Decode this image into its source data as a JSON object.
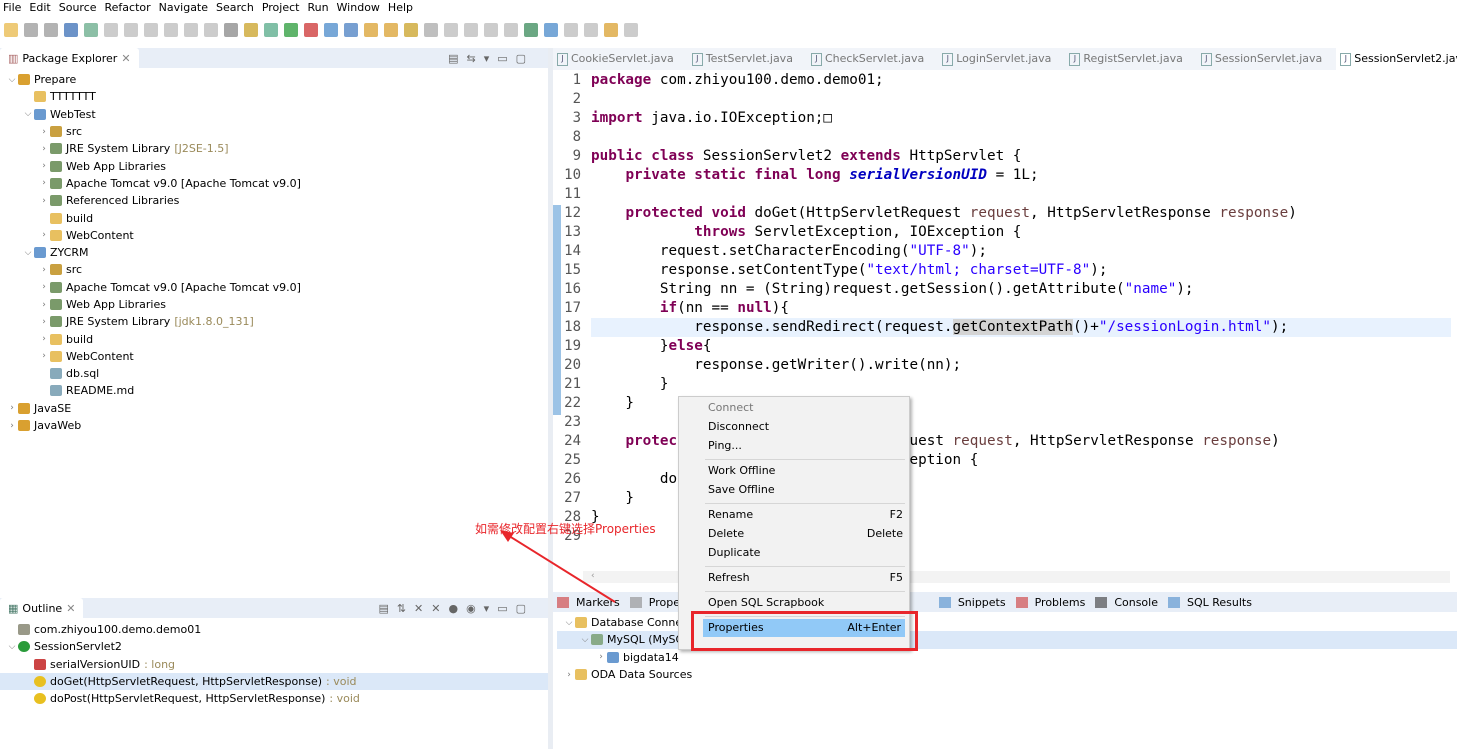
{
  "menu": [
    "File",
    "Edit",
    "Source",
    "Refactor",
    "Navigate",
    "Search",
    "Project",
    "Run",
    "Window",
    "Help"
  ],
  "package_explorer": {
    "title": "Package Explorer",
    "items": [
      {
        "label": "Prepare",
        "depth": 0,
        "open": true,
        "icon": "project-icon"
      },
      {
        "label": "TTTTTTT",
        "depth": 1,
        "icon": "folder-icon"
      },
      {
        "label": "WebTest",
        "depth": 1,
        "open": true,
        "icon": "web-project-icon"
      },
      {
        "label": "src",
        "depth": 2,
        "chev": true,
        "icon": "package-folder-icon"
      },
      {
        "label": "JRE System Library",
        "deco": "[J2SE-1.5]",
        "depth": 2,
        "chev": true,
        "icon": "library-icon"
      },
      {
        "label": "Web App Libraries",
        "depth": 2,
        "chev": true,
        "icon": "library-icon"
      },
      {
        "label": "Apache Tomcat v9.0 [Apache Tomcat v9.0]",
        "depth": 2,
        "chev": true,
        "icon": "library-icon"
      },
      {
        "label": "Referenced Libraries",
        "depth": 2,
        "chev": true,
        "icon": "library-icon"
      },
      {
        "label": "build",
        "depth": 2,
        "icon": "folder-icon"
      },
      {
        "label": "WebContent",
        "depth": 2,
        "chev": true,
        "icon": "folder-icon"
      },
      {
        "label": "ZYCRM",
        "depth": 1,
        "open": true,
        "icon": "web-project-icon"
      },
      {
        "label": "src",
        "depth": 2,
        "chev": true,
        "icon": "package-folder-icon"
      },
      {
        "label": "Apache Tomcat v9.0 [Apache Tomcat v9.0]",
        "depth": 2,
        "chev": true,
        "icon": "library-icon"
      },
      {
        "label": "Web App Libraries",
        "depth": 2,
        "chev": true,
        "icon": "library-icon"
      },
      {
        "label": "JRE System Library",
        "deco": "[jdk1.8.0_131]",
        "depth": 2,
        "chev": true,
        "icon": "library-icon"
      },
      {
        "label": "build",
        "depth": 2,
        "chev": true,
        "icon": "folder-icon"
      },
      {
        "label": "WebContent",
        "depth": 2,
        "chev": true,
        "icon": "folder-icon"
      },
      {
        "label": "db.sql",
        "depth": 2,
        "icon": "file-icon"
      },
      {
        "label": "README.md",
        "depth": 2,
        "icon": "file-icon"
      },
      {
        "label": "JavaSE",
        "depth": 0,
        "chev": true,
        "icon": "project-icon"
      },
      {
        "label": "JavaWeb",
        "depth": 0,
        "chev": true,
        "icon": "project-icon"
      }
    ]
  },
  "outline": {
    "title": "Outline",
    "items": [
      {
        "label": "com.zhiyou100.demo.demo01",
        "depth": 0,
        "icon": "package-icon"
      },
      {
        "label": "SessionServlet2",
        "depth": 0,
        "open": true,
        "icon": "class-icon"
      },
      {
        "label": "serialVersionUID",
        "deco": ": long",
        "depth": 1,
        "icon": "field-icon"
      },
      {
        "label": "doGet(HttpServletRequest, HttpServletResponse)",
        "deco": ": void",
        "depth": 1,
        "icon": "method-icon",
        "selected": true
      },
      {
        "label": "doPost(HttpServletRequest, HttpServletResponse)",
        "deco": ": void",
        "depth": 1,
        "icon": "method-icon"
      }
    ]
  },
  "editor": {
    "tabs": [
      "CookieServlet.java",
      "TestServlet.java",
      "CheckServlet.java",
      "LoginServlet.java",
      "RegistServlet.java",
      "SessionServlet.java",
      "SessionServlet2.java"
    ],
    "active_tab": 6,
    "lines": [
      {
        "n": "1",
        "h": "<span class=kw>package</span> com.zhiyou100.demo.demo01;"
      },
      {
        "n": "2",
        "h": ""
      },
      {
        "n": "3",
        "h": "<span class=kw>import</span> java.io.IOException;&#9633;"
      },
      {
        "n": "8",
        "h": ""
      },
      {
        "n": "9",
        "h": "<span class=kw>public class</span> SessionServlet2 <span class=kw>extends</span> HttpServlet {"
      },
      {
        "n": "10",
        "h": "    <span class=kw>private static final long</span> <span class=fi>serialVersionUID</span> = 1L;"
      },
      {
        "n": "11",
        "h": ""
      },
      {
        "n": "12",
        "h": "    <span class=kw>protected void</span> doGet(HttpServletRequest <span style='color:#6a3e3e'>request</span>, HttpServletResponse <span style='color:#6a3e3e'>response</span>)"
      },
      {
        "n": "13",
        "h": "            <span class=kw>throws</span> ServletException, IOException {"
      },
      {
        "n": "14",
        "h": "        request.setCharacterEncoding(<span class=st>\"UTF-8\"</span>);"
      },
      {
        "n": "15",
        "h": "        response.setContentType(<span class=st>\"text/html; charset=UTF-8\"</span>);"
      },
      {
        "n": "16",
        "h": "        String nn = (String)request.getSession().getAttribute(<span class=st>\"name\"</span>);"
      },
      {
        "n": "17",
        "h": "        <span class=kw>if</span>(nn == <span class=kw>null</span>){"
      },
      {
        "n": "18",
        "h": "            response.sendRedirect(request.<span style='background:#d4d4d4'>getContextPath</span>()+<span class=st>\"/sessionLogin.html\"</span>);"
      },
      {
        "n": "19",
        "h": "        }<span class=kw>else</span>{"
      },
      {
        "n": "20",
        "h": "            response.getWriter().write(nn);"
      },
      {
        "n": "21",
        "h": "        }"
      },
      {
        "n": "22",
        "h": "    }"
      },
      {
        "n": "23",
        "h": ""
      },
      {
        "n": "24",
        "h": "    <span class=kw>protec</span>                        Request <span style='color:#6a3e3e'>request</span>, HttpServletResponse <span style='color:#6a3e3e'>response</span>)"
      },
      {
        "n": "25",
        "h": "                                IOException {"
      },
      {
        "n": "26",
        "h": "        do"
      },
      {
        "n": "27",
        "h": "    }"
      },
      {
        "n": "28",
        "h": "}"
      },
      {
        "n": "29",
        "h": ""
      }
    ]
  },
  "bottom": {
    "tabs": [
      "Markers",
      "Propert",
      "Snippets",
      "Problems",
      "Console",
      "SQL Results"
    ],
    "tree": [
      {
        "label": "Database Connec",
        "depth": 0,
        "open": true
      },
      {
        "label": "MySQL (MySQL v. 5.5.49)",
        "depth": 1,
        "open": true,
        "selected": true
      },
      {
        "label": "bigdata14",
        "depth": 2,
        "chev": true
      },
      {
        "label": "ODA Data Sources",
        "depth": 0,
        "chev": true
      }
    ]
  },
  "context_menu": {
    "items": [
      {
        "label": "Connect",
        "disabled": true
      },
      {
        "label": "Disconnect"
      },
      {
        "label": "Ping..."
      },
      {
        "sep": true
      },
      {
        "label": "Work Offline"
      },
      {
        "label": "Save Offline"
      },
      {
        "sep": true
      },
      {
        "label": "Rename",
        "shortcut": "F2"
      },
      {
        "label": "Delete",
        "shortcut": "Delete"
      },
      {
        "label": "Duplicate"
      },
      {
        "sep": true
      },
      {
        "label": "Refresh",
        "shortcut": "F5"
      },
      {
        "sep": true
      },
      {
        "label": "Open SQL Scrapbook"
      },
      {
        "sep": true
      },
      {
        "label": "Properties",
        "shortcut": "Alt+Enter",
        "highlighted": true
      }
    ]
  },
  "annotation": {
    "text": "如需修改配置右键选择Properties",
    "color": "#e8262b"
  }
}
